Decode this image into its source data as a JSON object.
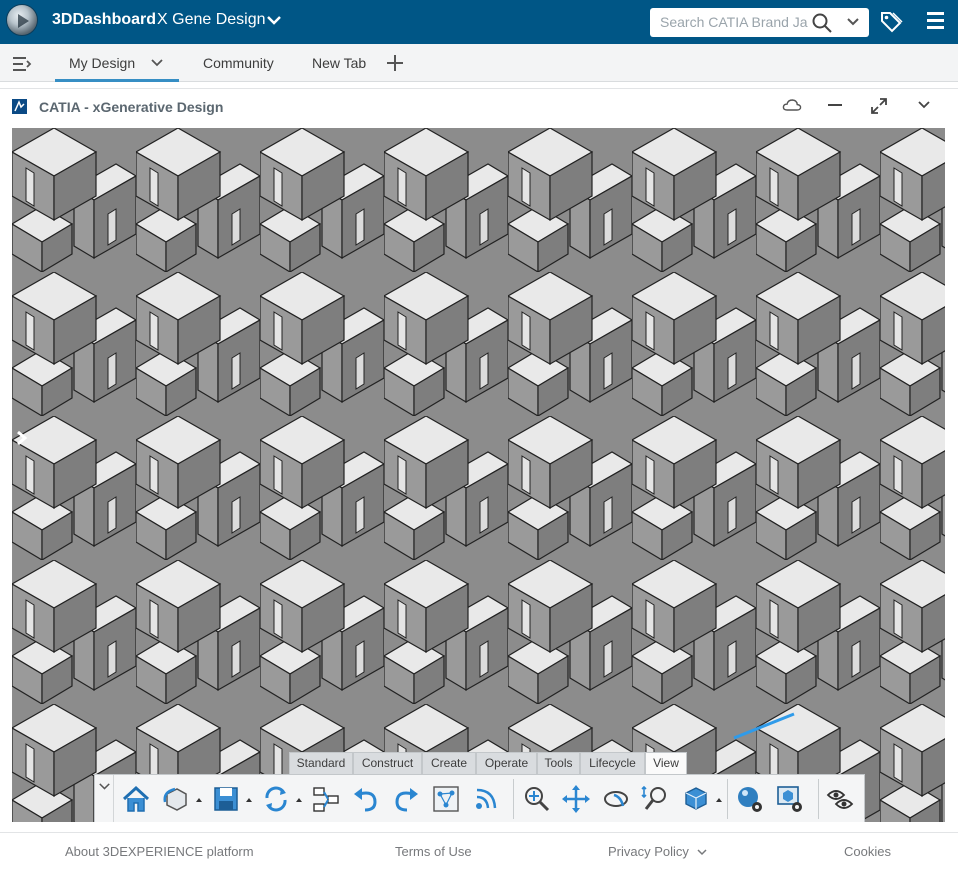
{
  "header": {
    "app_name": "3DDashboard",
    "dashboard_name": "X Gene Design",
    "search": {
      "placeholder": "Search CATIA Brand Ja"
    }
  },
  "tabs": {
    "items": [
      {
        "label": "My Design",
        "active": true
      },
      {
        "label": "Community"
      },
      {
        "label": "New Tab"
      }
    ]
  },
  "widget": {
    "title": "CATIA - xGenerative Design",
    "controls": [
      "cloud-icon",
      "minimize-icon",
      "maximize-icon",
      "chevron-down-icon"
    ]
  },
  "action_bar": {
    "tabs": [
      "Standard",
      "Construct",
      "Create",
      "Operate",
      "Tools",
      "Lifecycle",
      "View"
    ],
    "active_tab": "View",
    "tools": [
      "home-icon",
      "orbit-view-icon",
      "save-icon",
      "refresh-sync-icon",
      "tree-compare-icon",
      "undo-icon",
      "redo-icon",
      "graph-editor-icon",
      "broadcast-icon",
      "zoom-area-icon",
      "pan-icon",
      "rotate-icon",
      "zoom-in-out-icon",
      "isometric-view-icon",
      "material-settings-icon",
      "display-settings-icon",
      "hide-show-icon"
    ]
  },
  "footer": {
    "about": "About 3DEXPERIENCE platform",
    "terms": "Terms of Use",
    "privacy": "Privacy Policy",
    "cookies": "Cookies"
  },
  "colors": {
    "topbar": "#005686",
    "tab_accent": "#368ec4",
    "model_gray": "#8c8c8c",
    "selection_blue": "#2f9bea"
  }
}
